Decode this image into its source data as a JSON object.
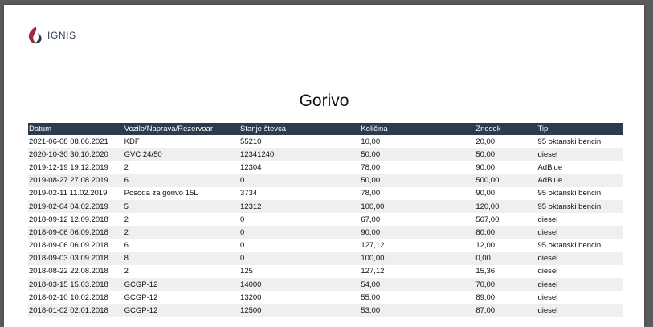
{
  "brand": {
    "name": "IGNIS",
    "color": "#9c2a3c"
  },
  "document": {
    "title": "Gorivo"
  },
  "table": {
    "header_color": "#2b3c4e",
    "columns": [
      "Datum",
      "Vozilo/Naprava/Rezervoar",
      "Stanje števca",
      "Količina",
      "Znesek",
      "Tip"
    ],
    "rows": [
      [
        "2021-06-08 08.06.2021",
        "KDF",
        "55210",
        "10,00",
        "20,00",
        "95 oktanski bencin"
      ],
      [
        "2020-10-30 30.10.2020",
        "GVC 24/50",
        "12341240",
        "50,00",
        "50,00",
        "diesel"
      ],
      [
        "2019-12-19 19.12.2019",
        "2",
        "12304",
        "78,00",
        "90,00",
        "AdBlue"
      ],
      [
        "2019-08-27 27.08.2019",
        "6",
        "0",
        "50,00",
        "500,00",
        "AdBlue"
      ],
      [
        "2019-02-11 11.02.2019",
        "Posoda za gorivo 15L",
        "3734",
        "78,00",
        "90,00",
        "95 oktanski bencin"
      ],
      [
        "2019-02-04 04.02.2019",
        "5",
        "12312",
        "100,00",
        "120,00",
        "95 oktanski bencin"
      ],
      [
        "2018-09-12 12.09.2018",
        "2",
        "0",
        "67,00",
        "567,00",
        "diesel"
      ],
      [
        "2018-09-06 06.09.2018",
        "2",
        "0",
        "90,00",
        "80,00",
        "diesel"
      ],
      [
        "2018-09-06 06.09.2018",
        "6",
        "0",
        "127,12",
        "12,00",
        "95 oktanski bencin"
      ],
      [
        "2018-09-03 03.09.2018",
        "8",
        "0",
        "100,00",
        "0,00",
        "diesel"
      ],
      [
        "2018-08-22 22.08.2018",
        "2",
        "125",
        "127,12",
        "15,36",
        "diesel"
      ],
      [
        "2018-03-15 15.03.2018",
        "GCGP-12",
        "14000",
        "54,00",
        "70,00",
        "diesel"
      ],
      [
        "2018-02-10 10.02.2018",
        "GCGP-12",
        "13200",
        "55,00",
        "89,00",
        "diesel"
      ],
      [
        "2018-01-02 02.01.2018",
        "GCGP-12",
        "12500",
        "53,00",
        "87,00",
        "diesel"
      ]
    ]
  }
}
